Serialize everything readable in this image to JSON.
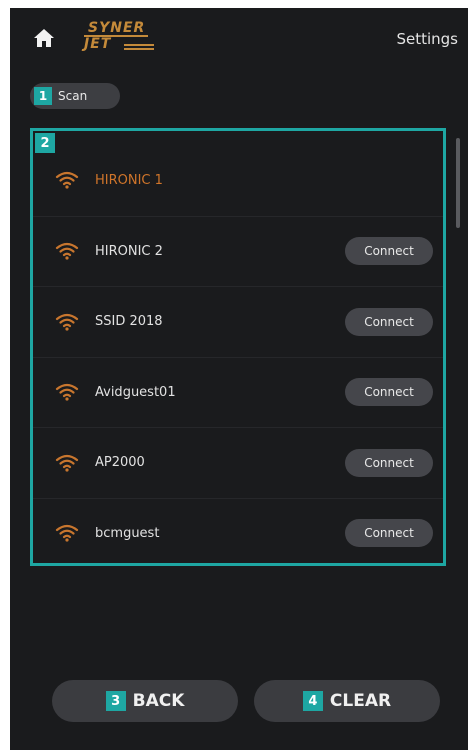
{
  "header": {
    "logo": {
      "line1": "SYNER",
      "line2": "JET"
    },
    "title": "Settings",
    "icons": {
      "home": "home-icon"
    }
  },
  "scan": {
    "badge": "1",
    "label": "Scan"
  },
  "list": {
    "badge": "2",
    "networks": [
      {
        "ssid": "HIRONIC 1",
        "connected": true,
        "button": ""
      },
      {
        "ssid": "HIRONIC 2",
        "connected": false,
        "button": "Connect"
      },
      {
        "ssid": "SSID 2018",
        "connected": false,
        "button": "Connect"
      },
      {
        "ssid": "Avidguest01",
        "connected": false,
        "button": "Connect"
      },
      {
        "ssid": "AP2000",
        "connected": false,
        "button": "Connect"
      },
      {
        "ssid": "bcmguest",
        "connected": false,
        "button": "Connect"
      }
    ]
  },
  "footer": {
    "back": {
      "badge": "3",
      "label": "BACK"
    },
    "clear": {
      "badge": "4",
      "label": "CLEAR"
    }
  },
  "colors": {
    "background": "#1a1b1d",
    "accent_teal": "#1ea7a3",
    "active_orange": "#d0752a",
    "button_gray": "#45464b",
    "logo_gold": "#c48a3a"
  }
}
